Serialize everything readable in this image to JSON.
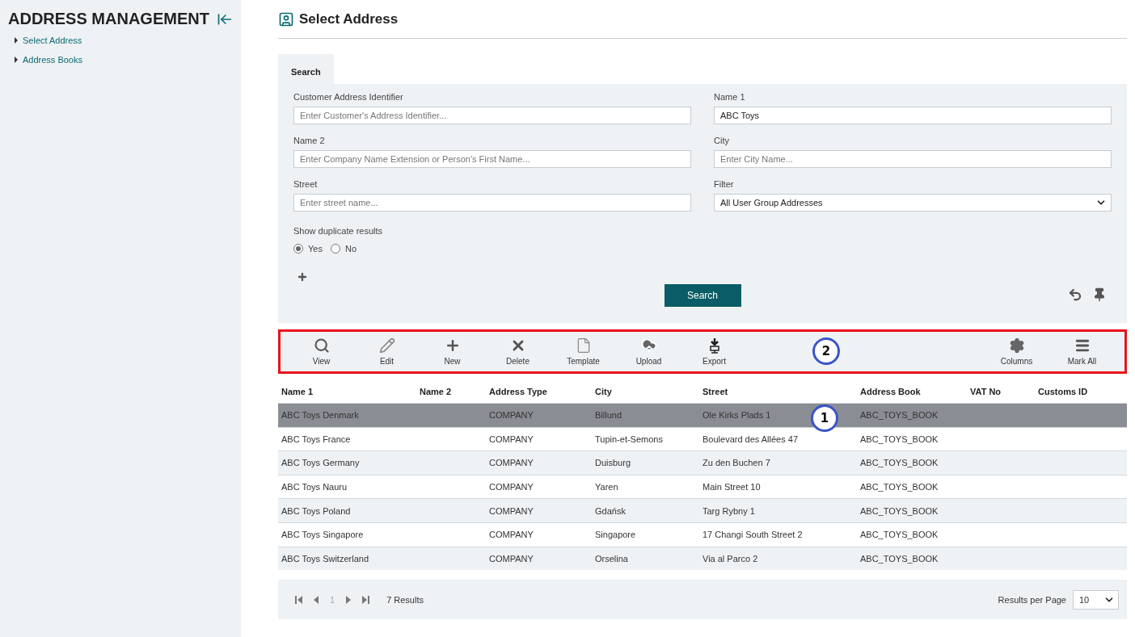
{
  "sidebar": {
    "title": "ADDRESS MANAGEMENT",
    "items": [
      {
        "label": "Select Address"
      },
      {
        "label": "Address Books"
      }
    ]
  },
  "page": {
    "title": "Select Address"
  },
  "tabs": [
    {
      "label": "Search",
      "selected": true
    }
  ],
  "search_form": {
    "fields": [
      {
        "label": "Customer Address Identifier",
        "kind": "text",
        "placeholder": "Enter Customer's Address Identifier..."
      },
      {
        "label": "Name 1",
        "kind": "text",
        "value": "ABC Toys"
      },
      {
        "label": "Name 2",
        "kind": "text",
        "placeholder": "Enter Company Name Extension or Person's First Name..."
      },
      {
        "label": "City",
        "kind": "text",
        "placeholder": "Enter City Name..."
      },
      {
        "label": "Street",
        "kind": "text",
        "placeholder": "Enter street name..."
      },
      {
        "label": "Filter",
        "kind": "select",
        "value": "All User Group Addresses"
      }
    ],
    "duplicates": {
      "label": "Show duplicate results",
      "options": [
        {
          "label": "Yes",
          "selected": true
        },
        {
          "label": "No",
          "selected": false
        }
      ]
    },
    "search_button": "Search"
  },
  "toolbar": {
    "highlighted": true,
    "callout": "2",
    "left": [
      {
        "label": "View"
      },
      {
        "label": "Edit"
      },
      {
        "label": "New"
      },
      {
        "label": "Delete"
      },
      {
        "label": "Template"
      },
      {
        "label": "Upload"
      },
      {
        "label": "Export"
      }
    ],
    "right": [
      {
        "label": "Columns"
      },
      {
        "label": "Mark All"
      }
    ]
  },
  "table": {
    "callout": "1",
    "columns": [
      "Name 1",
      "Name 2",
      "Address Type",
      "City",
      "Street",
      "Address Book",
      "VAT No",
      "Customs ID"
    ],
    "rows": [
      {
        "selected": true,
        "cells": [
          "ABC Toys Denmark",
          "",
          "COMPANY",
          "Billund",
          "Ole Kirks Plads 1",
          "ABC_TOYS_BOOK",
          "",
          ""
        ]
      },
      {
        "selected": false,
        "cells": [
          "ABC Toys France",
          "",
          "COMPANY",
          "Tupin-et-Semons",
          "Boulevard des Allées 47",
          "ABC_TOYS_BOOK",
          "",
          ""
        ]
      },
      {
        "selected": false,
        "cells": [
          "ABC Toys Germany",
          "",
          "COMPANY",
          "Duisburg",
          "Zu den Buchen 7",
          "ABC_TOYS_BOOK",
          "",
          ""
        ]
      },
      {
        "selected": false,
        "cells": [
          "ABC Toys Nauru",
          "",
          "COMPANY",
          "Yaren",
          "Main Street 10",
          "ABC_TOYS_BOOK",
          "",
          ""
        ]
      },
      {
        "selected": false,
        "cells": [
          "ABC Toys Poland",
          "",
          "COMPANY",
          "Gdańsk",
          "Targ Rybny 1",
          "ABC_TOYS_BOOK",
          "",
          ""
        ]
      },
      {
        "selected": false,
        "cells": [
          "ABC Toys Singapore",
          "",
          "COMPANY",
          "Singapore",
          "17 Changi South Street 2",
          "ABC_TOYS_BOOK",
          "",
          ""
        ]
      },
      {
        "selected": false,
        "cells": [
          "ABC Toys Switzerland",
          "",
          "COMPANY",
          "Orselina",
          "Via al Parco 2",
          "ABC_TOYS_BOOK",
          "",
          ""
        ]
      }
    ]
  },
  "pagination": {
    "page": "1",
    "results": "7 Results",
    "per_page_label": "Results per Page",
    "per_page": "10"
  }
}
